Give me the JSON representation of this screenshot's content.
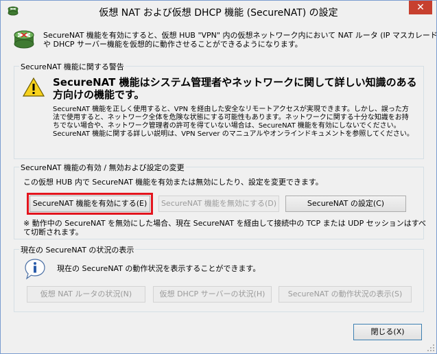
{
  "window": {
    "title": "仮想 NAT および仮想 DHCP 機能 (SecureNAT) の設定",
    "close_glyph": "✕"
  },
  "intro": {
    "line1": "SecureNAT 機能を有効にすると、仮想 HUB \"VPN\" 内の仮想ネットワーク内において NAT ルータ (IP マスカレード)",
    "line2": "や DHCP サーバー機能を仮想的に動作させることができるようになります。"
  },
  "warning": {
    "group_label": "SecureNAT 機能に関する警告",
    "heading_line1": "SecureNAT 機能はシステム管理者やネットワークに関して詳しい知識のある",
    "heading_line2": "方向けの機能です。",
    "body_line1": "SecureNAT 機能を正しく使用すると、VPN を経由した安全なリモートアクセスが実現できます。しかし、誤った方",
    "body_line2": "法で使用すると、ネットワーク全体を危険な状態にする可能性もあります。ネットワークに関する十分な知識をお持",
    "body_line3": "ちでない場合や、ネットワーク管理者の許可を得ていない場合は、SecureNAT 機能を有効にしないでください。",
    "body_line4": "SecureNAT 機能に関する詳しい説明は、VPN Server のマニュアルやオンラインドキュメントを参照してください。"
  },
  "toggle": {
    "group_label": "SecureNAT 機能の有効 / 無効および設定の変更",
    "description": "この仮想 HUB 内で SecureNAT 機能を有効または無効にしたり、設定を変更できます。",
    "enable_label": "SecureNAT 機能を有効にする(E)",
    "disable_label": "SecureNAT 機能を無効にする(D)",
    "settings_label": "SecureNAT の設定(C)",
    "note_line1": "※ 動作中の SecureNAT を無効にした場合、現在 SecureNAT を経由して接続中の TCP または UDP セッションはすべ",
    "note_line2": "て切断されます。"
  },
  "status": {
    "group_label": "現在の SecureNAT の状況の表示",
    "description": "現在の SecureNAT の動作状況を表示することができます。",
    "nat_status_label": "仮想 NAT ルータの状況(N)",
    "dhcp_status_label": "仮想 DHCP サーバーの状況(H)",
    "securenat_status_label": "SecureNAT の動作状況の表示(S)"
  },
  "footer": {
    "close_label": "閉じる(X)"
  }
}
